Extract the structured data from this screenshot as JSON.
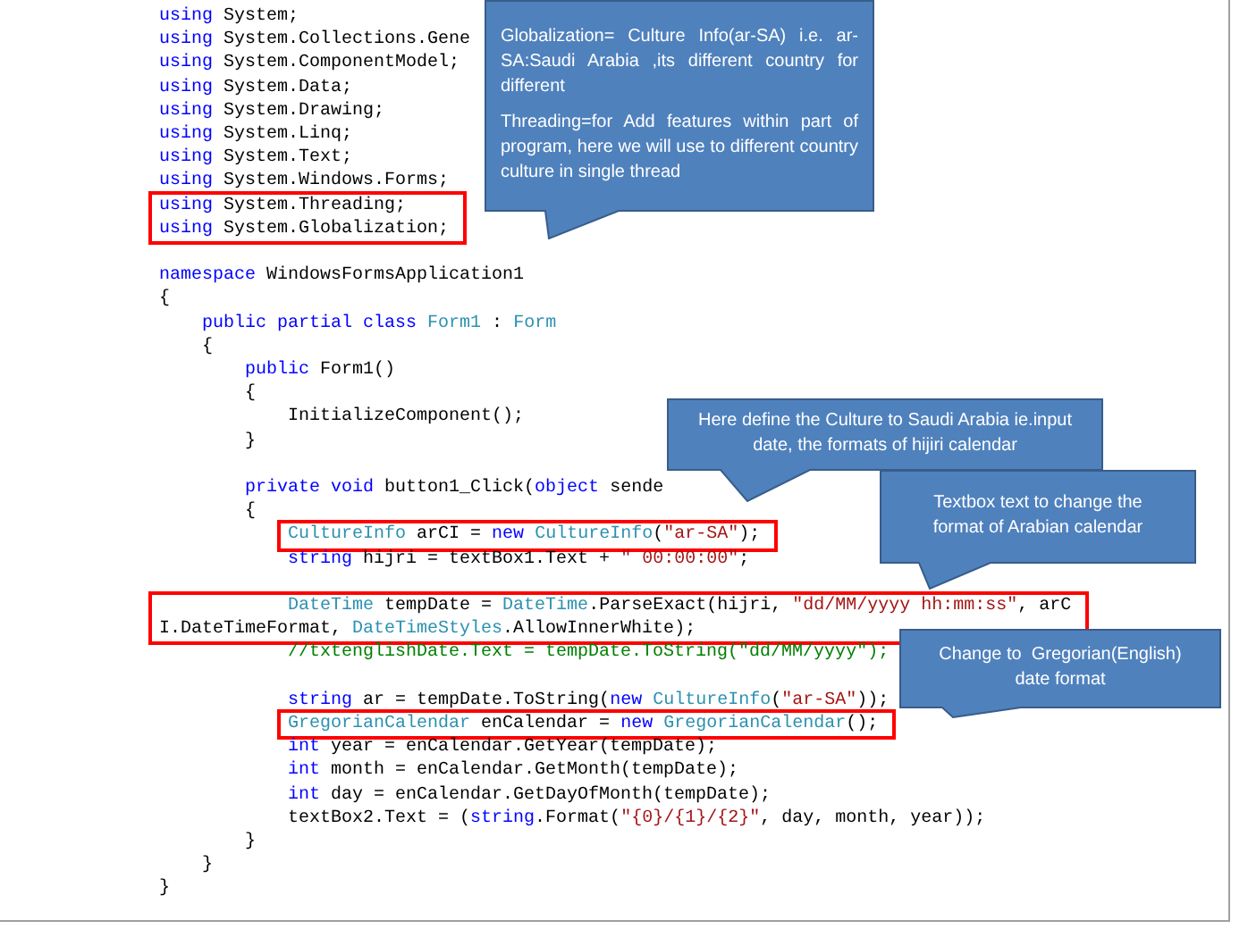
{
  "code": [
    {
      "highlighted": false,
      "lines": [
        {
          "kind": "code",
          "tokens": [
            {
              "kind": "kw",
              "text": "using"
            },
            {
              "kind": "plain",
              "text": " System;"
            }
          ]
        },
        {
          "kind": "code",
          "tokens": [
            {
              "kind": "kw",
              "text": "using"
            },
            {
              "kind": "plain",
              "text": " System.Collections.Gene"
            }
          ]
        },
        {
          "kind": "code",
          "tokens": [
            {
              "kind": "kw",
              "text": "using"
            },
            {
              "kind": "plain",
              "text": " System.ComponentModel;"
            }
          ]
        },
        {
          "kind": "code",
          "tokens": [
            {
              "kind": "kw",
              "text": "using"
            },
            {
              "kind": "plain",
              "text": " System.Data;"
            }
          ]
        },
        {
          "kind": "code",
          "tokens": [
            {
              "kind": "kw",
              "text": "using"
            },
            {
              "kind": "plain",
              "text": " System.Drawing;"
            }
          ]
        },
        {
          "kind": "code",
          "tokens": [
            {
              "kind": "kw",
              "text": "using"
            },
            {
              "kind": "plain",
              "text": " System.Linq;"
            }
          ]
        },
        {
          "kind": "code",
          "tokens": [
            {
              "kind": "kw",
              "text": "using"
            },
            {
              "kind": "plain",
              "text": " System.Text;"
            }
          ]
        },
        {
          "kind": "code",
          "tokens": [
            {
              "kind": "kw",
              "text": "using"
            },
            {
              "kind": "plain",
              "text": " System.Windows.Forms;"
            }
          ]
        }
      ]
    },
    {
      "highlighted": true,
      "lines": [
        {
          "kind": "code",
          "tokens": [
            {
              "kind": "kw",
              "text": "using"
            },
            {
              "kind": "plain",
              "text": " System.Threading;"
            }
          ]
        },
        {
          "kind": "code",
          "tokens": [
            {
              "kind": "kw",
              "text": "using"
            },
            {
              "kind": "plain",
              "text": " System.Globalization;"
            }
          ]
        }
      ]
    },
    {
      "highlighted": false,
      "lines": [
        {
          "kind": "blank"
        },
        {
          "kind": "code",
          "tokens": [
            {
              "kind": "kw",
              "text": "namespace"
            },
            {
              "kind": "plain",
              "text": " WindowsFormsApplication1"
            }
          ]
        },
        {
          "kind": "code",
          "tokens": [
            {
              "kind": "plain",
              "text": "{"
            }
          ]
        },
        {
          "kind": "code",
          "tokens": [
            {
              "kind": "kw",
              "text": "    public partial class"
            },
            {
              "kind": "type",
              "text": " Form1"
            },
            {
              "kind": "plain",
              "text": " : "
            },
            {
              "kind": "type",
              "text": "Form"
            }
          ]
        },
        {
          "kind": "code",
          "tokens": [
            {
              "kind": "plain",
              "text": "    {"
            }
          ]
        },
        {
          "kind": "code",
          "tokens": [
            {
              "kind": "kw",
              "text": "        public"
            },
            {
              "kind": "plain",
              "text": " Form1()"
            }
          ]
        },
        {
          "kind": "code",
          "tokens": [
            {
              "kind": "plain",
              "text": "        {"
            }
          ]
        },
        {
          "kind": "code",
          "tokens": [
            {
              "kind": "plain",
              "text": "            InitializeComponent();"
            }
          ]
        },
        {
          "kind": "code",
          "tokens": [
            {
              "kind": "plain",
              "text": "        }"
            }
          ]
        },
        {
          "kind": "blank"
        },
        {
          "kind": "code",
          "tokens": [
            {
              "kind": "kw",
              "text": "        private void"
            },
            {
              "kind": "plain",
              "text": " button1_Click("
            },
            {
              "kind": "kw",
              "text": "object"
            },
            {
              "kind": "plain",
              "text": " sende"
            }
          ]
        },
        {
          "kind": "code",
          "tokens": [
            {
              "kind": "plain",
              "text": "        {"
            }
          ]
        }
      ]
    },
    {
      "highlighted": true,
      "lines": [
        {
          "kind": "code",
          "tokens": [
            {
              "kind": "type",
              "text": "            CultureInfo"
            },
            {
              "kind": "plain",
              "text": " arCI = "
            },
            {
              "kind": "kw",
              "text": "new"
            },
            {
              "kind": "type",
              "text": " CultureInfo"
            },
            {
              "kind": "plain",
              "text": "("
            },
            {
              "kind": "str",
              "text": "\"ar-SA\""
            },
            {
              "kind": "plain",
              "text": ");"
            }
          ]
        }
      ]
    },
    {
      "highlighted": false,
      "lines": [
        {
          "kind": "code",
          "tokens": [
            {
              "kind": "kw",
              "text": "            string"
            },
            {
              "kind": "plain",
              "text": " hijri = textBox1.Text + "
            },
            {
              "kind": "str",
              "text": "\" 00:00:00\""
            },
            {
              "kind": "plain",
              "text": ";"
            }
          ]
        },
        {
          "kind": "blank"
        }
      ]
    },
    {
      "highlighted": true,
      "lines": [
        {
          "kind": "code",
          "tokens": [
            {
              "kind": "type",
              "text": "            DateTime"
            },
            {
              "kind": "plain",
              "text": " tempDate = "
            },
            {
              "kind": "type",
              "text": "DateTime"
            },
            {
              "kind": "plain",
              "text": ".ParseExact(hijri, "
            },
            {
              "kind": "str",
              "text": "\"dd/MM/yyyy hh:mm:ss\""
            },
            {
              "kind": "plain",
              "text": ", arC"
            }
          ]
        },
        {
          "kind": "code",
          "tokens": [
            {
              "kind": "plain",
              "text": "I.DateTimeFormat, "
            },
            {
              "kind": "type",
              "text": "DateTimeStyles"
            },
            {
              "kind": "plain",
              "text": ".AllowInnerWhite);"
            }
          ]
        }
      ]
    },
    {
      "highlighted": false,
      "lines": [
        {
          "kind": "code",
          "tokens": [
            {
              "kind": "comment",
              "text": "            //txtenglishDate.Text = tempDate.ToString(\"dd/MM/yyyy\");"
            }
          ]
        },
        {
          "kind": "blank"
        },
        {
          "kind": "code",
          "tokens": [
            {
              "kind": "kw",
              "text": "            string"
            },
            {
              "kind": "plain",
              "text": " ar = tempDate.ToString("
            },
            {
              "kind": "kw",
              "text": "new"
            },
            {
              "kind": "type",
              "text": " CultureInfo"
            },
            {
              "kind": "plain",
              "text": "("
            },
            {
              "kind": "str",
              "text": "\"ar-SA\""
            },
            {
              "kind": "plain",
              "text": "));"
            }
          ]
        }
      ]
    },
    {
      "highlighted": true,
      "lines": [
        {
          "kind": "code",
          "tokens": [
            {
              "kind": "type",
              "text": "            GregorianCalendar"
            },
            {
              "kind": "plain",
              "text": " enCalendar = "
            },
            {
              "kind": "kw",
              "text": "new"
            },
            {
              "kind": "type",
              "text": " GregorianCalendar"
            },
            {
              "kind": "plain",
              "text": "();"
            }
          ]
        }
      ]
    },
    {
      "highlighted": false,
      "lines": [
        {
          "kind": "code",
          "tokens": [
            {
              "kind": "kw",
              "text": "            int"
            },
            {
              "kind": "plain",
              "text": " year = enCalendar.GetYear(tempDate);"
            }
          ]
        },
        {
          "kind": "code",
          "tokens": [
            {
              "kind": "kw",
              "text": "            int"
            },
            {
              "kind": "plain",
              "text": " month = enCalendar.GetMonth(tempDate);"
            }
          ]
        },
        {
          "kind": "code",
          "tokens": [
            {
              "kind": "kw",
              "text": "            int"
            },
            {
              "kind": "plain",
              "text": " day = enCalendar.GetDayOfMonth(tempDate);"
            }
          ]
        },
        {
          "kind": "code",
          "tokens": [
            {
              "kind": "plain",
              "text": "            textBox2.Text = ("
            },
            {
              "kind": "kw",
              "text": "string"
            },
            {
              "kind": "plain",
              "text": ".Format("
            },
            {
              "kind": "str",
              "text": "\"{0}/{1}/{2}\""
            },
            {
              "kind": "plain",
              "text": ", day, month, year));"
            }
          ]
        },
        {
          "kind": "code",
          "tokens": [
            {
              "kind": "plain",
              "text": "        }"
            }
          ]
        },
        {
          "kind": "code",
          "tokens": [
            {
              "kind": "plain",
              "text": "    }"
            }
          ]
        },
        {
          "kind": "code",
          "tokens": [
            {
              "kind": "plain",
              "text": "}"
            }
          ]
        }
      ]
    }
  ],
  "callouts": [
    {
      "paragraphs": [
        "Globalization= Culture Info(ar-SA) i.e. ar-SA:Saudi Arabia ,its different country for different",
        "Threading=for Add features within part of program, here we will use to different country culture in single thread"
      ]
    },
    {
      "paragraphs": [
        "Here define the Culture to Saudi Arabia ie.input date, the formats of hijiri calendar"
      ]
    },
    {
      "paragraphs": [
        "Textbox text to change the format of Arabian calendar"
      ]
    },
    {
      "paragraphs": [
        "Change to  Gregorian(English) date format"
      ]
    }
  ]
}
